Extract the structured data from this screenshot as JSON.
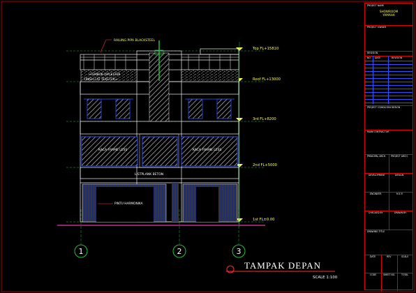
{
  "drawing": {
    "title": "TAMPAK DEPAN",
    "scale": "SCALE 1:100",
    "grid_labels": [
      "1",
      "2",
      "3"
    ],
    "levels": [
      "Top FL+15810",
      "Roof FL+13000",
      "3rd FL+8200",
      "2nd FL+5000",
      "1st FL±0.00"
    ],
    "annotations": {
      "railing": "RAILING PIPA BLACKSTEEL",
      "wall": "TEMBOK DIPLESTER\nFINISH CAT TEKSTUR",
      "glass_left": "KACA FRAME LESS",
      "glass_right": "KACA FRAME LESS",
      "listplank": "LISTPLANK BETON",
      "door": "PINTU HARMONIKA"
    }
  },
  "title_block": {
    "project_name_label": "PROJECT NAME",
    "project_name": "SHOWROOM\nYAMAHA",
    "project_owner_label": "PROJECT OWNER",
    "revision_label": "REVISION",
    "revision_cols": [
      "NO",
      "DATE",
      "REVISION"
    ],
    "consultant_label": "PROJECT CONSULTAN DESIGN",
    "contractor_label": "MAIN CONTRACTOR",
    "principal_label": "PRINCIPAL ARCH.",
    "project_arch_label": "PROJECT ARCH.",
    "development_label": "DEVELOPMENT",
    "design_label": "DESIGN",
    "engineer_label": "ENGINEER",
    "mep_label": "M.E.P.",
    "checked_label": "CHECKED BY",
    "drawn_label": "DRAWN BY",
    "drawing_title_label": "DRAWING TITLE",
    "footer_row1": [
      "DATE",
      "REV",
      "SCALE"
    ],
    "footer_row2": [
      "CODE",
      "SHEET NO.",
      "TOTAL"
    ]
  },
  "colors": {
    "background": "#000000",
    "frame": "#dd0000",
    "building": "#f0f0f0",
    "glass_blue": "#3050ff",
    "hatch": "#b0b0b0",
    "level_text": "#ffff40",
    "dim_green": "#20c040",
    "annotation_red": "#ff3030",
    "ground": "#c03090"
  }
}
